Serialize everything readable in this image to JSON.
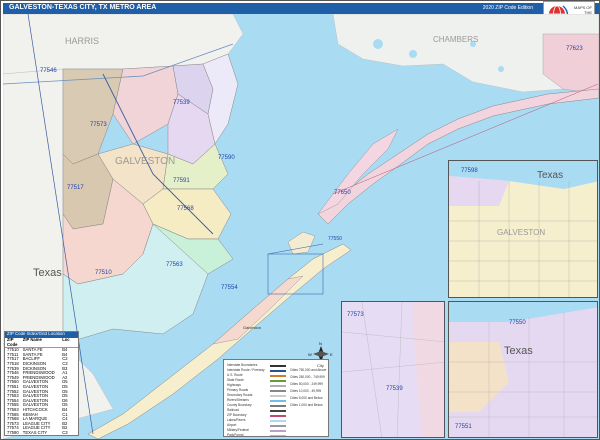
{
  "title": "GALVESTON-TEXAS CITY, TX METRO AREA",
  "edition": "2020 ZIP Code Edition",
  "brand": {
    "lines": [
      "MAPS OF",
      "THE WORLD"
    ]
  },
  "colors": {
    "water": "#a9dbf3",
    "land_outside": "#f2f2f0",
    "title_bar": "#1f5fa8"
  },
  "place_labels": {
    "harris": "HARRIS",
    "chambers": "CHAMBERS",
    "texas_main": "Texas",
    "galveston_county": "GALVESTON",
    "galveston_city": "Galveston",
    "texas_inset": "Texas",
    "galveston_inset": "GALVESTON",
    "texas_inset3": "Texas"
  },
  "zip_labels": [
    "77546",
    "77573",
    "77510",
    "77517",
    "77539",
    "77591",
    "77568",
    "77590",
    "77563",
    "77554",
    "77650",
    "77550",
    "77623",
    "77598"
  ],
  "inset_labels": {
    "inset1_zip": "77598",
    "inset2_zip_a": "77573",
    "inset2_zip_b": "77539",
    "inset3_zip_a": "77550",
    "inset3_zip_b": "77551"
  },
  "compass": {
    "n": "N",
    "s": "S",
    "e": "E",
    "w": "W"
  },
  "city_label": "City",
  "zip_table": {
    "title": "ZIP Code Index/Grid Location",
    "headers": [
      "ZIP Code",
      "ZIP Name",
      "Loc"
    ],
    "rows": [
      [
        "77510",
        "SANTA FE",
        "B4"
      ],
      [
        "77511",
        "SANTA FE",
        "B4"
      ],
      [
        "77517",
        "BACLIFF",
        "C2"
      ],
      [
        "77518",
        "DICKINSON",
        "C3"
      ],
      [
        "77539",
        "DICKINSON",
        "B3"
      ],
      [
        "77546",
        "FRIENDSWOOD",
        "A1"
      ],
      [
        "77549",
        "FRIENDSWOOD",
        "A2"
      ],
      [
        "77550",
        "GALVESTON",
        "D5"
      ],
      [
        "77551",
        "GALVESTON",
        "D5"
      ],
      [
        "77552",
        "GALVESTON",
        "D5"
      ],
      [
        "77553",
        "GALVESTON",
        "D5"
      ],
      [
        "77554",
        "GALVESTON",
        "D6"
      ],
      [
        "77555",
        "GALVESTON",
        "D5"
      ],
      [
        "77563",
        "HITCHCOCK",
        "B4"
      ],
      [
        "77565",
        "KEMAH",
        "C1"
      ],
      [
        "77568",
        "LA MARQUE",
        "C4"
      ],
      [
        "77573",
        "LEAGUE CITY",
        "B2"
      ],
      [
        "77574",
        "LEAGUE CITY",
        "B2"
      ],
      [
        "77590",
        "TEXAS CITY",
        "C3"
      ],
      [
        "77591",
        "TEXAS CITY",
        "C3"
      ],
      [
        "77592",
        "TEXAS CITY",
        "C3"
      ],
      [
        "77617",
        "GILCHRIST",
        "F4"
      ],
      [
        "77623",
        "HIGH ISLAND",
        "G2"
      ],
      [
        "77650",
        "PORT BOLIVAR",
        "E4"
      ]
    ]
  },
  "legend": {
    "rows": [
      "Interstate Boundaries",
      "Interstate Route / Freeway",
      "U.S. Route",
      "State Route",
      "Highways",
      "Primary Roads",
      "Secondary Roads",
      "Rivers/Streams",
      "County Boundary",
      "Railroad",
      "ZIP Boundary",
      "Lakes/Rivers",
      "Airport",
      "Military/Federal",
      "Park/Forest"
    ],
    "right": [
      "Cities 750,000 and Above",
      "Cities 250,000 - 749,999",
      "Cities 50,000 - 249,999",
      "Cities 10,000 - 49,999",
      "Cities 5,000 and Below",
      "Cities 1,000 and Below"
    ]
  }
}
